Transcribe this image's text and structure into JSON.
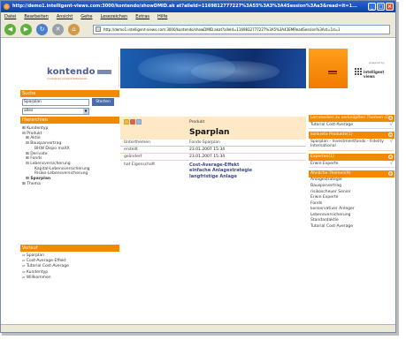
{
  "window": {
    "title": "http://demo1.intelligent-views.com:3000/kontendo/showDMID.ak at?alleId=1169812777227%3A55%3A3%3A4Session%3Aa3&read=it=1...",
    "url": "http://demo1.intelligent-views.com:3000/kontendo/showDMID.akat?alleId=1169812777227%3A5%3A43EMReadSession%3Ast=1d=1"
  },
  "menu": [
    "Datei",
    "Bearbeiten",
    "Ansicht",
    "Gehe",
    "Lesezeichen",
    "Extras",
    "Hilfe"
  ],
  "logo": {
    "text": "kontendo",
    "subtitle": "modulares content-datenbank",
    "powered": "powered by",
    "iv_name": "intelligent views"
  },
  "search": {
    "header": "Suche",
    "value": "Sparplan",
    "button": "Starten",
    "select_value": "alles"
  },
  "hierarchy": {
    "header": "Hierarchien",
    "items": [
      "⊞ Kundentyp",
      "⊟ Produkt",
      "⊞ Aktie",
      "⊟ Bausparvertrag",
      "BHW Dispo maXX",
      "⊞ Derivate",
      "⊞ Fonds",
      "⊟ Lebensversicherung",
      "Kapital-Lebensversicherung",
      "Risiko-Lebensversicherung",
      "⊞ Sparplan",
      "⊞ Thema"
    ]
  },
  "history": {
    "header": "Verlauf",
    "items": [
      "Sparplan",
      "Cost-Average-Effekt",
      "Tutorial Cost-Average",
      "Kundentyp",
      "Willkommen"
    ]
  },
  "main": {
    "category": "Produkt",
    "title": "Sparplan",
    "subtopics_label": "Unterthemen",
    "subtopics_value": "Fonds-Sparplan",
    "created_label": "erstellt",
    "created_value": "23.01.2007 15:34",
    "changed_label": "geändert",
    "changed_value": "23.01.2007 15:34",
    "property_label": "hat Eigenschaft",
    "properties": [
      "Cost-Average-Effekt",
      "einfache Anlagestrategie",
      "langfristige Anlage"
    ]
  },
  "right": {
    "sections": [
      {
        "header": "Lernmedien zu verknüpften Themen (1)",
        "items": [
          "Tutorial Cost-Average"
        ]
      },
      {
        "header": "konkrete Produkte(1)",
        "items": [
          "Sparplan - Investmentfonds - Fidelity International"
        ]
      },
      {
        "header": "Experten(1)",
        "items": [
          "Erwin Experte"
        ]
      }
    ],
    "similar": {
      "header": "Ähnliche Themen(9)",
      "items": [
        "Anlagestrategie",
        "Bausparvertrag",
        "risikoscheuer Senior",
        "Erwin Experte",
        "Fonds",
        "konservativer Anleger",
        "Lebensversicherung",
        "Standardaktie",
        "Tutorial Cost-Average"
      ]
    }
  }
}
